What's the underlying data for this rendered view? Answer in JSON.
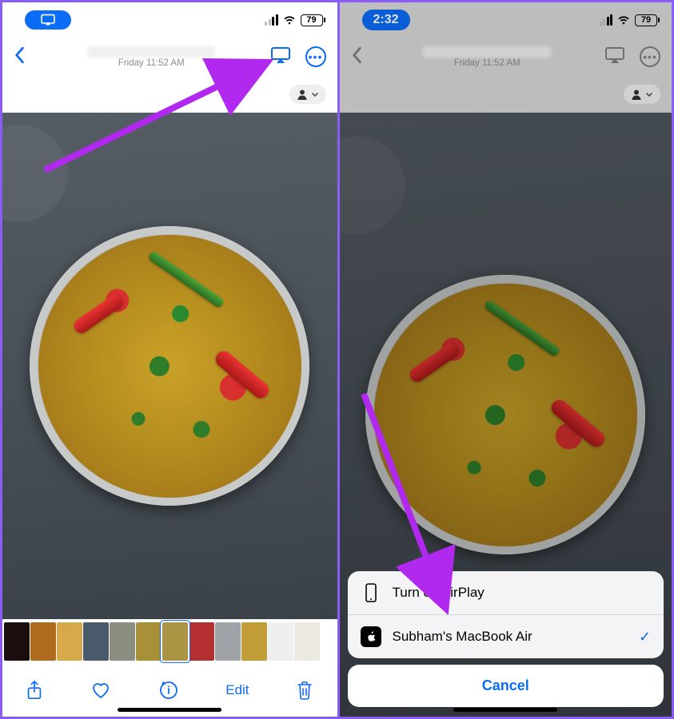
{
  "left": {
    "status": {
      "battery": "79"
    },
    "nav": {
      "subtitle": "Friday 11:52 AM"
    },
    "toolbar": {
      "edit": "Edit"
    }
  },
  "right": {
    "status": {
      "time": "2:32",
      "battery": "79"
    },
    "nav": {
      "subtitle": "Friday 11:52 AM"
    },
    "sheet": {
      "turnOff": "Turn off AirPlay",
      "device": "Subham's MacBook Air",
      "cancel": "Cancel"
    }
  },
  "thumb_colors": [
    "#1a0d0d",
    "#b06a1e",
    "#d8a94a",
    "#4a5a6a",
    "#8c8e82",
    "#a79038",
    "#a99544",
    "#b42f2f",
    "#9fa3a7",
    "#c29d38",
    "#eef0f0",
    "#ece9e2"
  ],
  "colors": {
    "accent": "#0b6cf5",
    "annotation": "#b128ee"
  }
}
